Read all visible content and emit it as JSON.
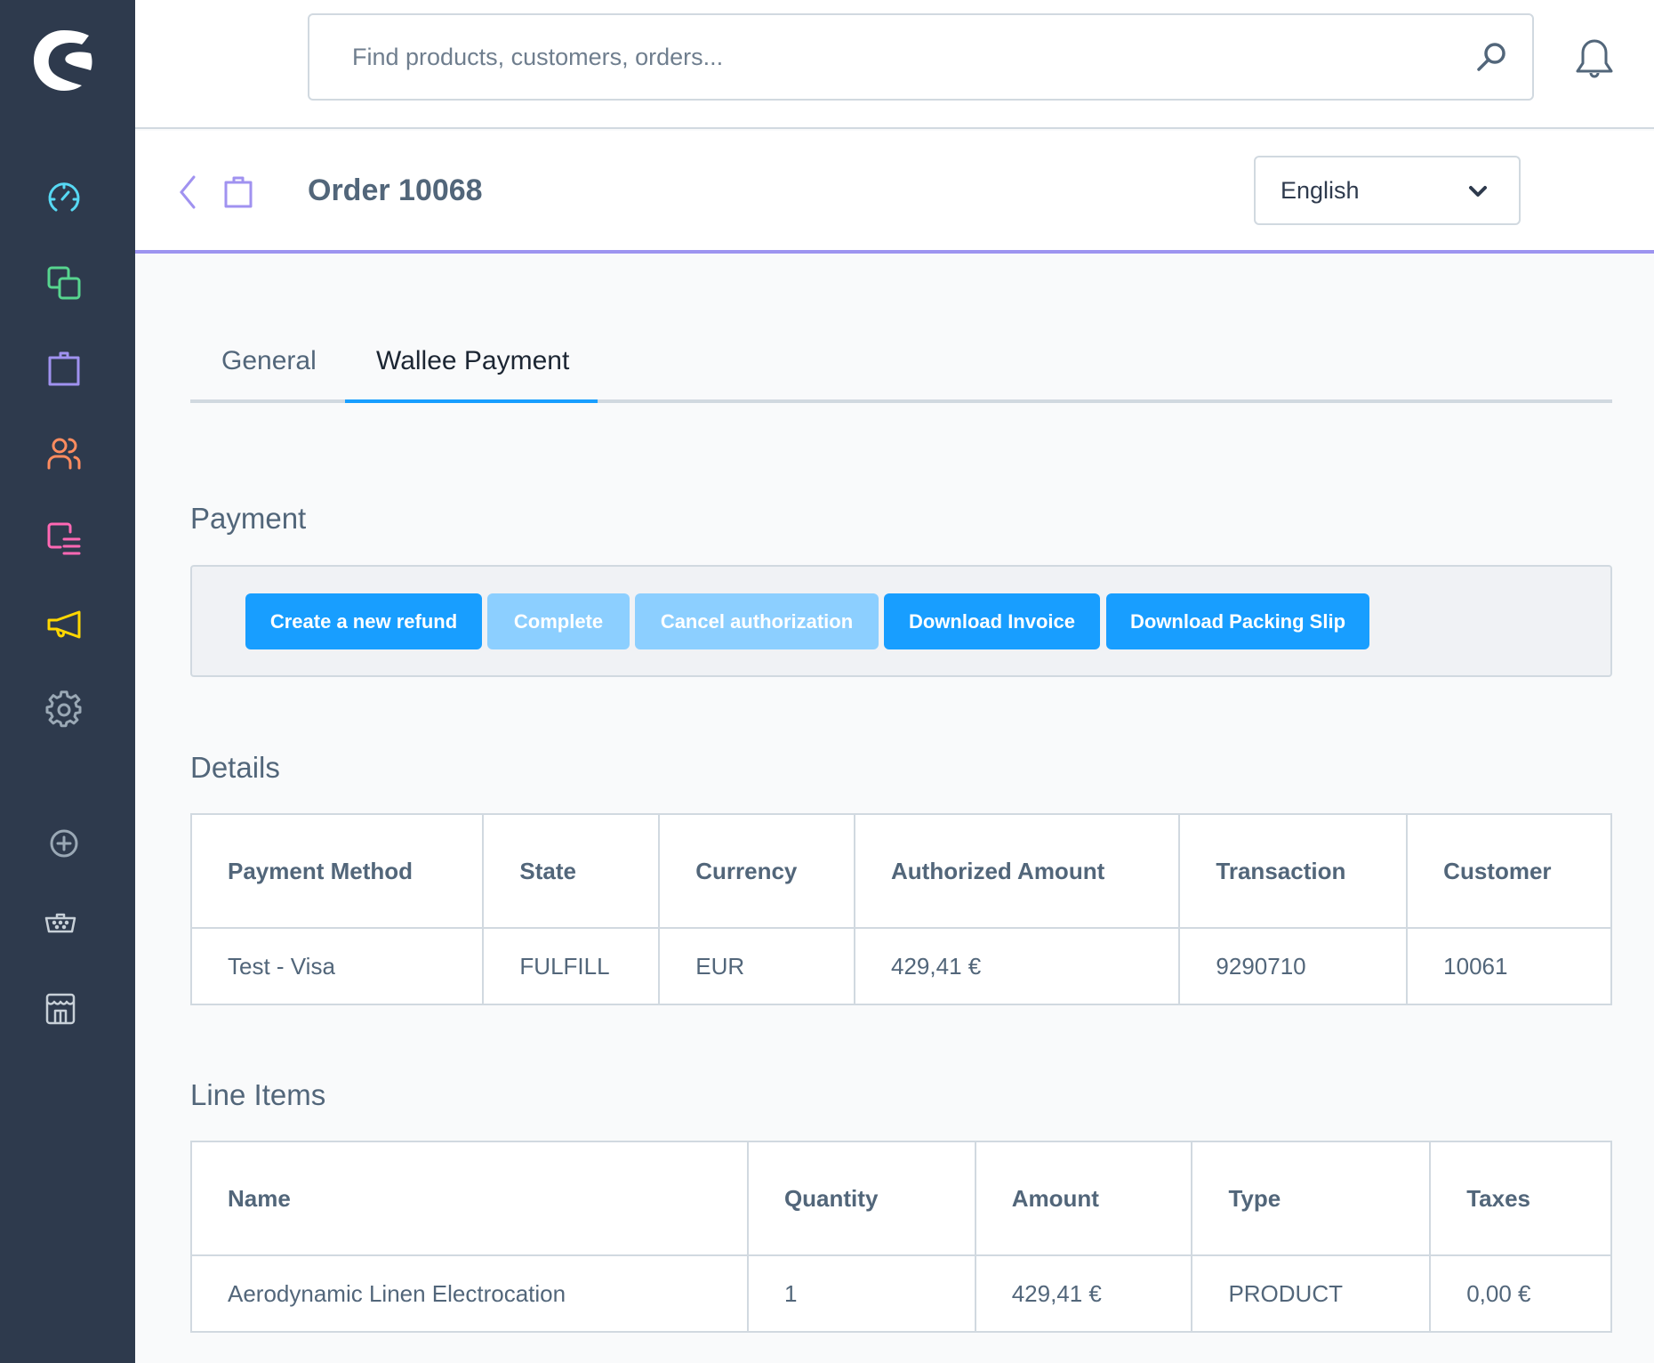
{
  "sidebar": {
    "logo": "shopware-logo",
    "items": [
      {
        "name": "dashboard",
        "icon": "gauge-icon",
        "color": "#57d9f4"
      },
      {
        "name": "catalogues",
        "icon": "duplicate-icon",
        "color": "#57d58f"
      },
      {
        "name": "orders",
        "icon": "shopping-bag-icon",
        "color": "#a092f0"
      },
      {
        "name": "customers",
        "icon": "users-icon",
        "color": "#ff8c5f"
      },
      {
        "name": "content",
        "icon": "content-list-icon",
        "color": "#ff68b4"
      },
      {
        "name": "marketing",
        "icon": "megaphone-icon",
        "color": "#ffd700"
      },
      {
        "name": "settings",
        "icon": "gear-icon",
        "color": "#9aa8b5"
      }
    ],
    "bottom_items": [
      {
        "name": "add",
        "icon": "plus-circle-icon"
      },
      {
        "name": "storefront-basket",
        "icon": "basket-icon"
      },
      {
        "name": "sales-channel",
        "icon": "storefront-icon"
      }
    ]
  },
  "search": {
    "placeholder": "Find products, customers, orders..."
  },
  "header": {
    "title": "Order 10068",
    "language": "English"
  },
  "tabs": [
    {
      "label": "General",
      "active": false
    },
    {
      "label": "Wallee Payment",
      "active": true
    }
  ],
  "payment": {
    "title": "Payment",
    "buttons": [
      {
        "label": "Create a new refund",
        "enabled": true
      },
      {
        "label": "Complete",
        "enabled": false
      },
      {
        "label": "Cancel authorization",
        "enabled": false
      },
      {
        "label": "Download Invoice",
        "enabled": true
      },
      {
        "label": "Download Packing Slip",
        "enabled": true
      }
    ]
  },
  "details": {
    "title": "Details",
    "columns": [
      "Payment Method",
      "State",
      "Currency",
      "Authorized Amount",
      "Transaction",
      "Customer"
    ],
    "rows": [
      [
        "Test - Visa",
        "FULFILL",
        "EUR",
        "429,41 €",
        "9290710",
        "10061"
      ]
    ]
  },
  "line_items": {
    "title": "Line Items",
    "columns": [
      "Name",
      "Quantity",
      "Amount",
      "Type",
      "Taxes"
    ],
    "rows": [
      [
        "Aerodynamic Linen Electrocation",
        "1",
        "429,41 €",
        "PRODUCT",
        "0,00 €"
      ]
    ]
  },
  "colors": {
    "primary": "#189eff",
    "primary_disabled": "#8ccfff",
    "accent": "#9d94f0",
    "sidebar_bg": "#2e3a4d"
  }
}
